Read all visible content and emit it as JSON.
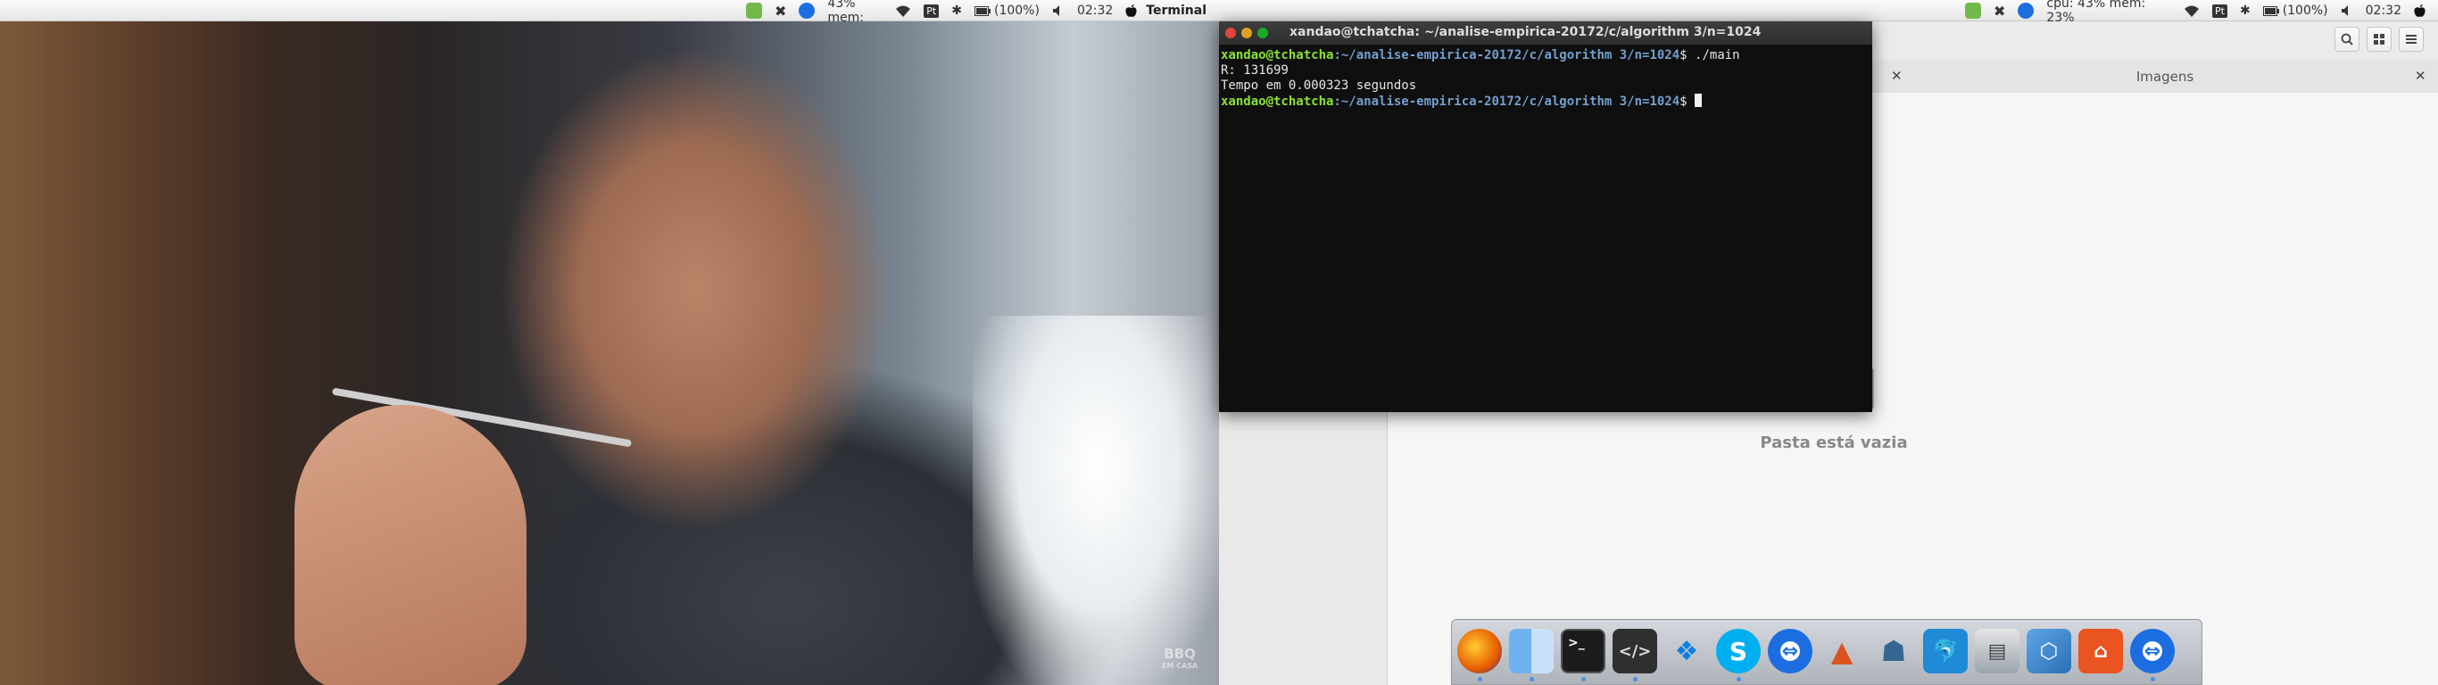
{
  "tray": {
    "cpu_mem": "cpu: 43% mem: 23%",
    "lang": "Pt",
    "battery": "(100%)",
    "time": "02:32",
    "app_name": "Terminal"
  },
  "terminal": {
    "title": "xandao@tchatcha: ~/analise-empirica-20172/c/algorithm 3/n=1024",
    "prompt_user": "xandao@tchatcha",
    "prompt_path": ":~/analise-empirica-20172/c/algorithm 3/n=1024",
    "prompt_symbol": "$",
    "command": " ./main",
    "output_line1": "R: 131699",
    "output_line2": "Tempo em 0.000323 segundos"
  },
  "files": {
    "tab_title": "Imagens",
    "empty_message": "Pasta está vazia"
  },
  "video": {
    "watermark_line1": "BBQ",
    "watermark_line2": "EM CASA"
  },
  "dock": {
    "apps": [
      "firefox-icon",
      "files-icon",
      "terminal-icon",
      "code-editor-icon",
      "dropbox-icon",
      "skype-icon",
      "teamviewer-icon",
      "matlab-icon",
      "postgresql-icon",
      "mysql-workbench-icon",
      "scanner-icon",
      "virtualbox-icon",
      "ubuntu-software-icon",
      "teamviewer-icon-2"
    ]
  },
  "colors": {
    "terminal_bg": "#0f0f0f",
    "prompt_user": "#8ae234",
    "prompt_path": "#729fcf",
    "close": "#e0443e",
    "minimize": "#dea123",
    "maximize": "#1aab29"
  }
}
